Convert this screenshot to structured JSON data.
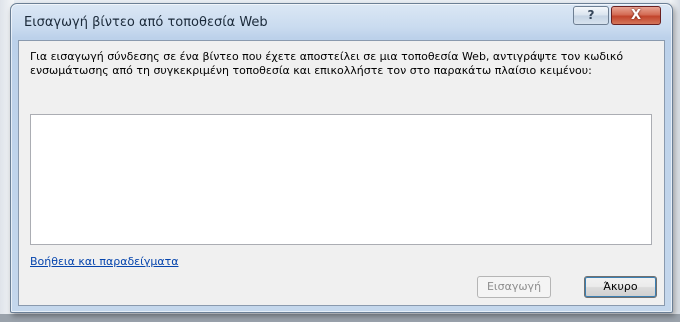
{
  "dialog": {
    "title": "Εισαγωγή βίντεο από τοποθεσία Web",
    "help_button": "?",
    "close_button": "X",
    "instructions": "Για εισαγωγή σύνδεσης σε ένα βίντεο που έχετε αποστείλει σε μια τοποθεσία Web, αντιγράψτε τον κωδικό ενσωμάτωσης από τη συγκεκριμένη τοποθεσία και επικολλήστε τον στο παρακάτω πλαίσιο κειμένου:",
    "embed_code_value": "",
    "help_link": "Βοήθεια και παραδείγματα",
    "insert_button": "Εισαγωγή",
    "cancel_button": "Άκυρο"
  },
  "colors": {
    "frame": "#c4d7ec",
    "close_button": "#c2442c",
    "link": "#0645ad",
    "disabled_text": "#8d8d8d"
  }
}
